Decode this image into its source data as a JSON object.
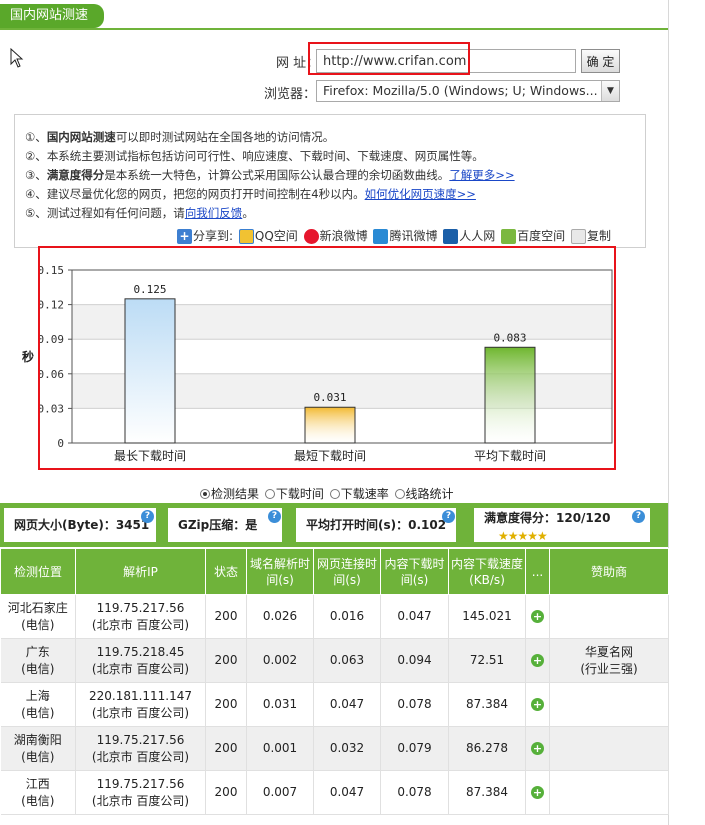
{
  "header": {
    "tab_title": "国内网站测速"
  },
  "form": {
    "url_label": "网 址：",
    "url_value": "http://www.crifan.com",
    "ok_label": "确 定",
    "browser_label": "浏览器：",
    "browser_value": "Firefox: Mozilla/5.0 (Windows; U; Windows..."
  },
  "info": {
    "lines": [
      {
        "prefix": "①、",
        "bold": "国内网站测速",
        "text": "可以即时测试网站在全国各地的访问情况。",
        "link": ""
      },
      {
        "prefix": "②、",
        "bold": "",
        "text": "本系统主要测试指标包括访问可行性、响应速度、下载时间、下载速度、网页属性等。",
        "link": ""
      },
      {
        "prefix": "③、",
        "bold": "满意度得分",
        "text": "是本系统一大特色，计算公式采用国际公认最合理的余切函数曲线。",
        "link": "了解更多>>"
      },
      {
        "prefix": "④、",
        "bold": "",
        "text": "建议尽量优化您的网页，把您的网页打开时间控制在4秒以内。",
        "link": "如何优化网页速度>>"
      },
      {
        "prefix": "⑤、",
        "bold": "",
        "text": "测试过程如有任何问题，请",
        "link": "向我们反馈",
        "suffix": "。"
      }
    ],
    "share": {
      "label": "分享到:",
      "items": [
        "QQ空间",
        "新浪微博",
        "腾讯微博",
        "人人网",
        "百度空间",
        "复制"
      ]
    }
  },
  "chart_data": {
    "type": "bar",
    "categories": [
      "最长下载时间",
      "最短下载时间",
      "平均下载时间"
    ],
    "values": [
      0.125,
      0.031,
      0.083
    ],
    "value_labels": [
      "0.125",
      "0.031",
      "0.083"
    ],
    "ylabel": "秒",
    "ylim": [
      0,
      0.15
    ],
    "yticks": [
      0,
      0.03,
      0.06,
      0.09,
      0.12,
      0.15
    ],
    "ytick_labels": [
      "0",
      "0.03",
      "0.06",
      "0.09",
      "0.12",
      "0.15"
    ],
    "colors": [
      "#bcdcf5",
      "#f2b930",
      "#6fb62f"
    ],
    "grid": true
  },
  "views": {
    "options": [
      "检测结果",
      "下载时间",
      "下载速率",
      "线路统计"
    ],
    "selected": 0
  },
  "stats": {
    "page_size": "网页大小(Byte)：3451",
    "gzip": "GZip压缩：是",
    "avg_open": "平均打开时间(s)：0.102",
    "score": "满意度得分：120/120",
    "help": "?",
    "stars": "★★★★★"
  },
  "table": {
    "headers": [
      "检测位置",
      "解析IP",
      "状态",
      "域名解析时间(s)",
      "网页连接时间(s)",
      "内容下载时间(s)",
      "内容下载速度(KB/s)",
      "...",
      "赞助商"
    ],
    "rows": [
      {
        "loc1": "河北石家庄",
        "loc2": "(电信)",
        "ip": "119.75.217.56",
        "ip_loc": "(北京市 百度公司)",
        "status": "200",
        "dns": "0.026",
        "conn": "0.016",
        "dl": "0.047",
        "speed": "145.021",
        "sponsor1": "",
        "sponsor2": ""
      },
      {
        "loc1": "广东",
        "loc2": "(电信)",
        "ip": "119.75.218.45",
        "ip_loc": "(北京市 百度公司)",
        "status": "200",
        "dns": "0.002",
        "conn": "0.063",
        "dl": "0.094",
        "speed": "72.51",
        "sponsor1": "华夏名网",
        "sponsor2": "(行业三强)"
      },
      {
        "loc1": "上海",
        "loc2": "(电信)",
        "ip": "220.181.111.147",
        "ip_loc": "(北京市 百度公司)",
        "status": "200",
        "dns": "0.031",
        "conn": "0.047",
        "dl": "0.078",
        "speed": "87.384",
        "sponsor1": "",
        "sponsor2": ""
      },
      {
        "loc1": "湖南衡阳",
        "loc2": "(电信)",
        "ip": "119.75.217.56",
        "ip_loc": "(北京市 百度公司)",
        "status": "200",
        "dns": "0.001",
        "conn": "0.032",
        "dl": "0.079",
        "speed": "86.278",
        "sponsor1": "",
        "sponsor2": ""
      },
      {
        "loc1": "江西",
        "loc2": "(电信)",
        "ip": "119.75.217.56",
        "ip_loc": "(北京市 百度公司)",
        "status": "200",
        "dns": "0.007",
        "conn": "0.047",
        "dl": "0.078",
        "speed": "87.384",
        "sponsor1": "",
        "sponsor2": ""
      }
    ]
  }
}
